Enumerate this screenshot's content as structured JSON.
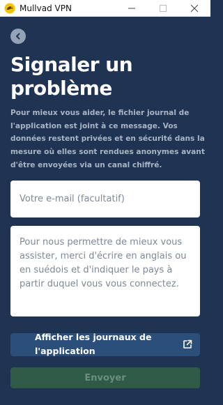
{
  "window": {
    "title": "Mullvad VPN",
    "minimize_glyph": "—",
    "maximize_glyph": "☐",
    "close_glyph": "✕",
    "logo_icon": "mullvad-logo-icon"
  },
  "header": {
    "back_icon": "chevron-left-icon"
  },
  "main": {
    "title": "Signaler un problème",
    "description": "Pour mieux vous aider, le fichier journal de l'application est joint à ce message. Vos données restent privées et en sécurité dans la mesure où elles sont rendues anonymes avant d'être envoyées via un canal chiffré.",
    "email_placeholder": "Votre e-mail (facultatif)",
    "email_value": "",
    "message_placeholder": "Pour nous permettre de mieux vous assister, merci d'écrire en anglais ou en suédois et d'indiquer le pays à partir duquel vous vous connectez.",
    "message_value": "",
    "logs_button_label": "Afficher les journaux de l'application",
    "logs_button_icon": "external-link-icon",
    "send_button_label": "Envoyer"
  },
  "colors": {
    "background": "#1f3352",
    "primary_button": "#2c4f7a",
    "send_button_disabled": "#2f5a45",
    "send_text_disabled": "#6c8e7d"
  }
}
